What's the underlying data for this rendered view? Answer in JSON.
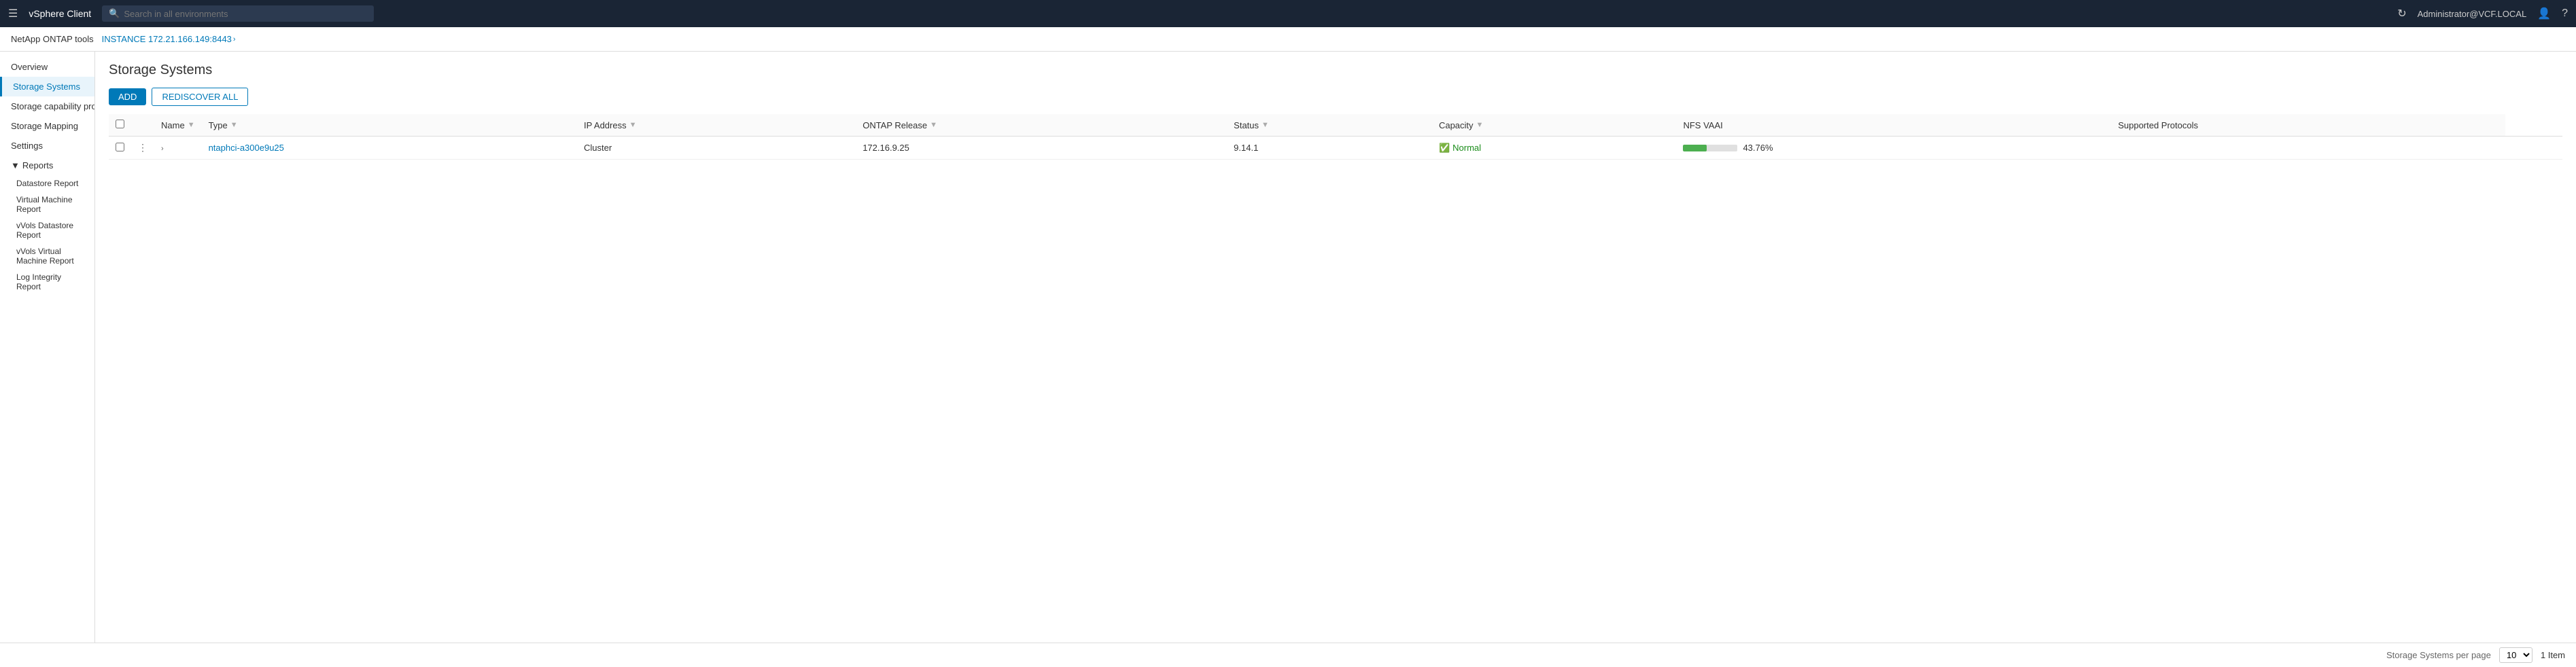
{
  "topNav": {
    "brand": "vSphere Client",
    "searchPlaceholder": "Search in all environments",
    "user": "Administrator@VCF.LOCAL",
    "menuIcon": "☰",
    "searchIconChar": "🔍",
    "refreshIconChar": "↻",
    "userIconChar": "👤",
    "helpIconChar": "?"
  },
  "breadcrumb": {
    "app": "NetApp ONTAP tools",
    "sep": "",
    "instance": "INSTANCE 172.21.166.149:8443",
    "chevron": "›"
  },
  "sidebar": {
    "items": [
      {
        "id": "overview",
        "label": "Overview",
        "active": false
      },
      {
        "id": "storage-systems",
        "label": "Storage Systems",
        "active": true
      },
      {
        "id": "storage-capability-profile",
        "label": "Storage capability profile",
        "active": false
      },
      {
        "id": "storage-mapping",
        "label": "Storage Mapping",
        "active": false
      },
      {
        "id": "settings",
        "label": "Settings",
        "active": false
      }
    ],
    "reports": {
      "label": "Reports",
      "subitems": [
        "Datastore Report",
        "Virtual Machine Report",
        "vVols Datastore Report",
        "vVols Virtual Machine Report",
        "Log Integrity Report"
      ]
    }
  },
  "mainTitle": "Storage Systems",
  "toolbar": {
    "addLabel": "ADD",
    "rediscoverLabel": "REDISCOVER ALL"
  },
  "table": {
    "columns": [
      {
        "id": "name",
        "label": "Name",
        "filterable": true
      },
      {
        "id": "type",
        "label": "Type",
        "filterable": true
      },
      {
        "id": "ip-address",
        "label": "IP Address",
        "filterable": true
      },
      {
        "id": "ontap-release",
        "label": "ONTAP Release",
        "filterable": true
      },
      {
        "id": "status",
        "label": "Status",
        "filterable": true
      },
      {
        "id": "capacity",
        "label": "Capacity",
        "filterable": true
      },
      {
        "id": "nfs-vaai",
        "label": "NFS VAAI",
        "filterable": false
      },
      {
        "id": "supported-protocols",
        "label": "Supported Protocols",
        "filterable": false
      }
    ],
    "rows": [
      {
        "name": "ntaphci-a300e9u25",
        "type": "Cluster",
        "ipAddress": "172.16.9.25",
        "ontapRelease": "9.14.1",
        "status": "Normal",
        "capacityPercent": 43.76,
        "capacityLabel": "43.76%",
        "nfsVaai": "",
        "supportedProtocols": ""
      }
    ]
  },
  "footer": {
    "perPageLabel": "Storage Systems per page",
    "perPageValue": "10",
    "itemCount": "1 Item"
  }
}
